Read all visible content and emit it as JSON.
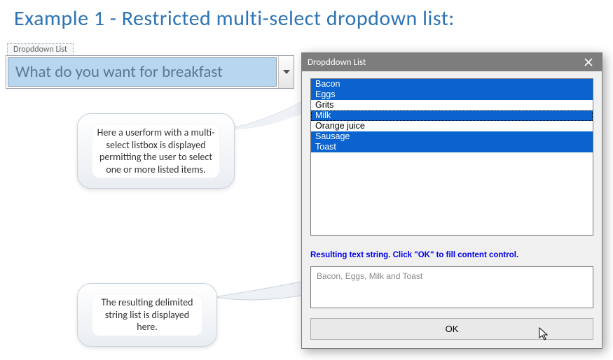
{
  "page_title": "Example 1 - Restricted multi-select dropdown list:",
  "content_control": {
    "tab_label": "Dropddown List",
    "field_text": "What do you want for breakfast"
  },
  "callouts": {
    "upper": "Here a userform with a multi-select listbox is displayed permitting the user to select one or more listed items.",
    "lower": "The resulting delimited string list is displayed here."
  },
  "dialog": {
    "title": "Dropddown List",
    "list_items": [
      {
        "label": "Bacon",
        "selected": true,
        "focused": false
      },
      {
        "label": "Eggs",
        "selected": true,
        "focused": false
      },
      {
        "label": "Grits",
        "selected": false,
        "focused": false
      },
      {
        "label": "Milk",
        "selected": true,
        "focused": true
      },
      {
        "label": "Orange juice",
        "selected": false,
        "focused": false
      },
      {
        "label": "Sausage",
        "selected": true,
        "focused": false
      },
      {
        "label": "Toast",
        "selected": true,
        "focused": false
      }
    ],
    "hint": "Resulting text string. Click \"OK\" to fill content control.",
    "result_text": "Bacon, Eggs, Milk and Toast",
    "ok_label": "OK"
  }
}
